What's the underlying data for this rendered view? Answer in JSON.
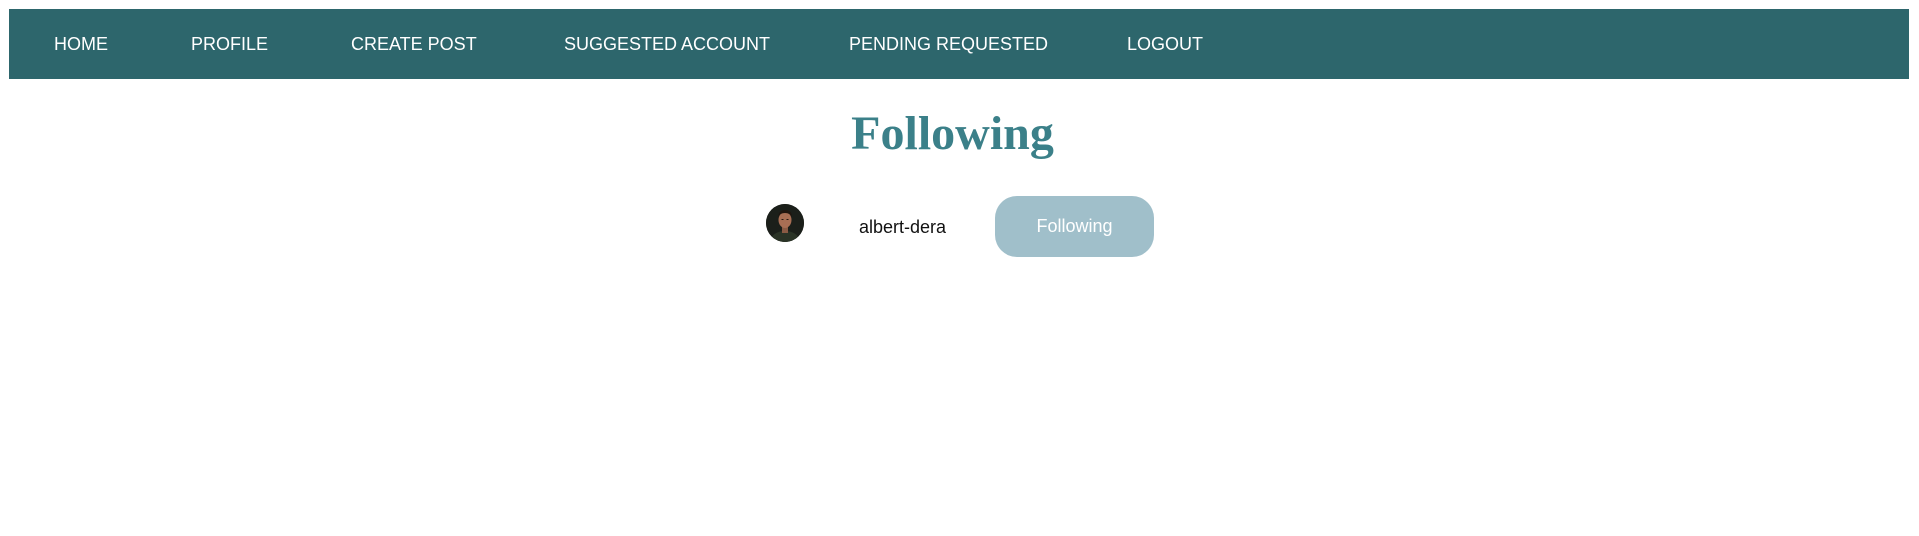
{
  "nav": {
    "home": "HOME",
    "profile": "PROFILE",
    "create_post": "CREATE POST",
    "suggested_account": "SUGGESTED ACCOUNT",
    "pending_requested": "PENDING REQUESTED",
    "logout": "LOGOUT"
  },
  "page": {
    "title": "Following"
  },
  "following": [
    {
      "username": "albert-dera",
      "button_label": "Following"
    }
  ],
  "colors": {
    "navbar_bg": "#2d666c",
    "title": "#3b8089",
    "button_bg": "#a0bfca"
  }
}
